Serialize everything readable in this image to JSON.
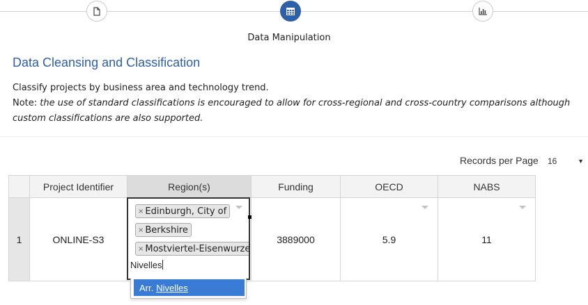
{
  "stepper": {
    "steps": [
      {
        "icon": "document-icon",
        "state": "inactive"
      },
      {
        "icon": "table-icon",
        "state": "active"
      },
      {
        "icon": "bar-chart-icon",
        "state": "inactive"
      }
    ],
    "current_label": "Data Manipulation",
    "active_color": "#2f5fa8"
  },
  "section": {
    "title": "Data Cleansing and Classification",
    "intro": "Classify projects by business area and technology trend.",
    "note_label": "Note:",
    "note_text": "the use of standard classifications is encouraged to allow for cross-regional and cross-country comparisons although custom classifications are also supported."
  },
  "pagination": {
    "records_label": "Records per Page",
    "records_value": "16"
  },
  "table": {
    "columns": [
      "",
      "Project Identifier",
      "Region(s)",
      "Funding",
      "OECD",
      "NABS"
    ],
    "rows": [
      {
        "row_number": "1",
        "project_identifier": "ONLINE-S3",
        "regions": [
          "Edinburgh, City of",
          "Berkshire",
          "Mostviertel-Eisenwurzen"
        ],
        "funding": "3889000",
        "oecd": "5.9",
        "nabs": "11"
      }
    ]
  },
  "region_editor": {
    "tag_remove_glyph": "×",
    "typed_text": "Nivelles",
    "suggestion_prefix": "Arr.",
    "suggestion_match": "Nivelles",
    "highlight_color": "#3a7bd5"
  }
}
